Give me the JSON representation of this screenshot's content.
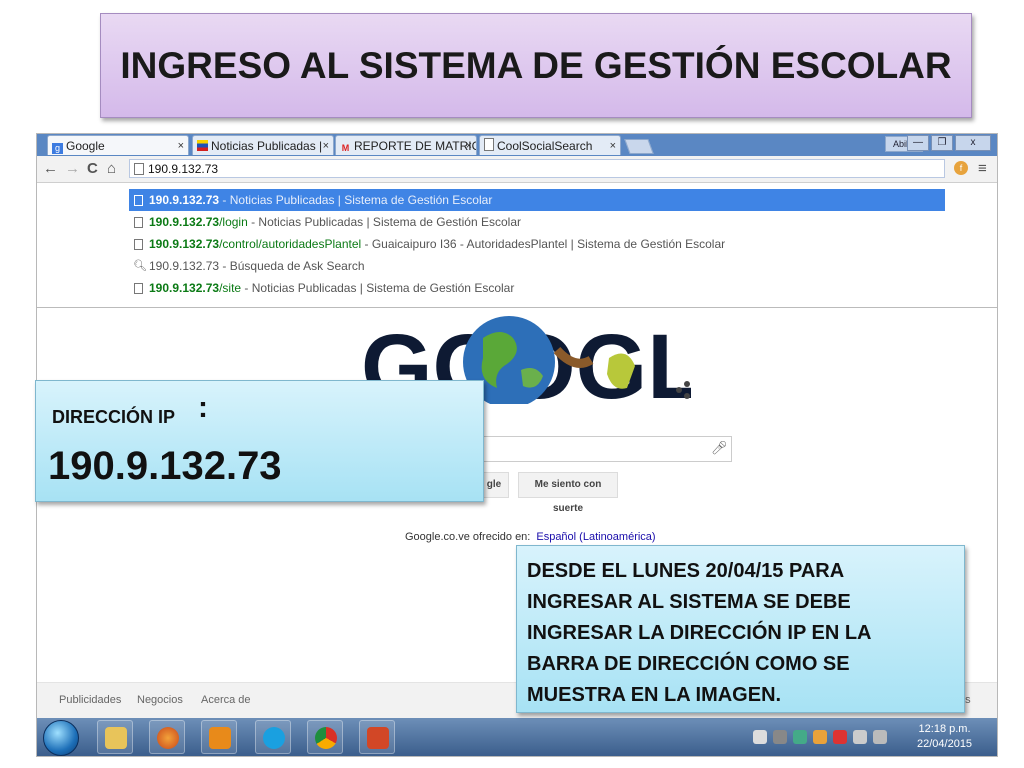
{
  "slide": {
    "title": "INGRESO AL SISTEMA DE GESTIÓN ESCOLAR"
  },
  "browser": {
    "tabs": [
      {
        "label": "Google",
        "active": true
      },
      {
        "label": "Noticias Publicadas |",
        "active": false
      },
      {
        "label": "REPORTE DE MATRIC",
        "active": false
      },
      {
        "label": "CoolSocialSearch",
        "active": false
      }
    ],
    "tab_close": "×",
    "user_label": "Abilio",
    "window_buttons": {
      "minimize": "—",
      "restore": "❐",
      "close": "x"
    },
    "nav": {
      "back": "←",
      "forward": "→",
      "reload": "C",
      "home": "⌂"
    },
    "address": "190.9.132.73",
    "suggestions": [
      {
        "host": "190.9.132.73",
        "path": "",
        "rest": " - Noticias Publicadas | Sistema de Gestión Escolar",
        "selected": true,
        "type": "page"
      },
      {
        "host": "190.9.132.73",
        "path": "/login",
        "rest": " - Noticias Publicadas | Sistema de Gestión Escolar",
        "selected": false,
        "type": "page"
      },
      {
        "host": "190.9.132.73",
        "path": "/control/autoridadesPlantel",
        "rest": " - Guaicaipuro I36 - AutoridadesPlantel | Sistema de Gestión Escolar",
        "selected": false,
        "type": "page"
      },
      {
        "host": "",
        "path": "",
        "rest": "190.9.132.73 - Búsqueda de Ask Search",
        "selected": false,
        "type": "search"
      },
      {
        "host": "190.9.132.73",
        "path": "/site",
        "rest": " - Noticias Publicadas | Sistema de Gestión Escolar",
        "selected": false,
        "type": "page"
      }
    ]
  },
  "google": {
    "doodle_text": "GOOGLE",
    "search_button_partial": "gle",
    "lucky_button": "Me siento con suerte",
    "offered_in": "Google.co.ve ofrecido en:",
    "language_link": "Español (Latinoamérica)",
    "footer": {
      "ads": "Publicidades",
      "business": "Negocios",
      "about": "Acerca de",
      "privacy": "as"
    }
  },
  "taskbar": {
    "time": "12:18 p.m.",
    "date": "22/04/2015"
  },
  "callouts": {
    "ip_label": "DIRECCIÓN IP",
    "ip_colon": ":",
    "ip_value": "190.9.132.73",
    "note": "DESDE EL LUNES 20/04/15 PARA\nINGRESAR AL SISTEMA SE DEBE\nINGRESAR LA DIRECCIÓN IP EN LA\nBARRA DE DIRECCIÓN COMO SE\nMUESTRA EN LA IMAGEN."
  },
  "colors": {
    "title_bg": "#d4b9ea",
    "callout_bg": "#a7e2f4",
    "selected_suggestion": "#3f84e5",
    "url_green": "#0b7a15",
    "tab_strip": "#5a87c3"
  }
}
